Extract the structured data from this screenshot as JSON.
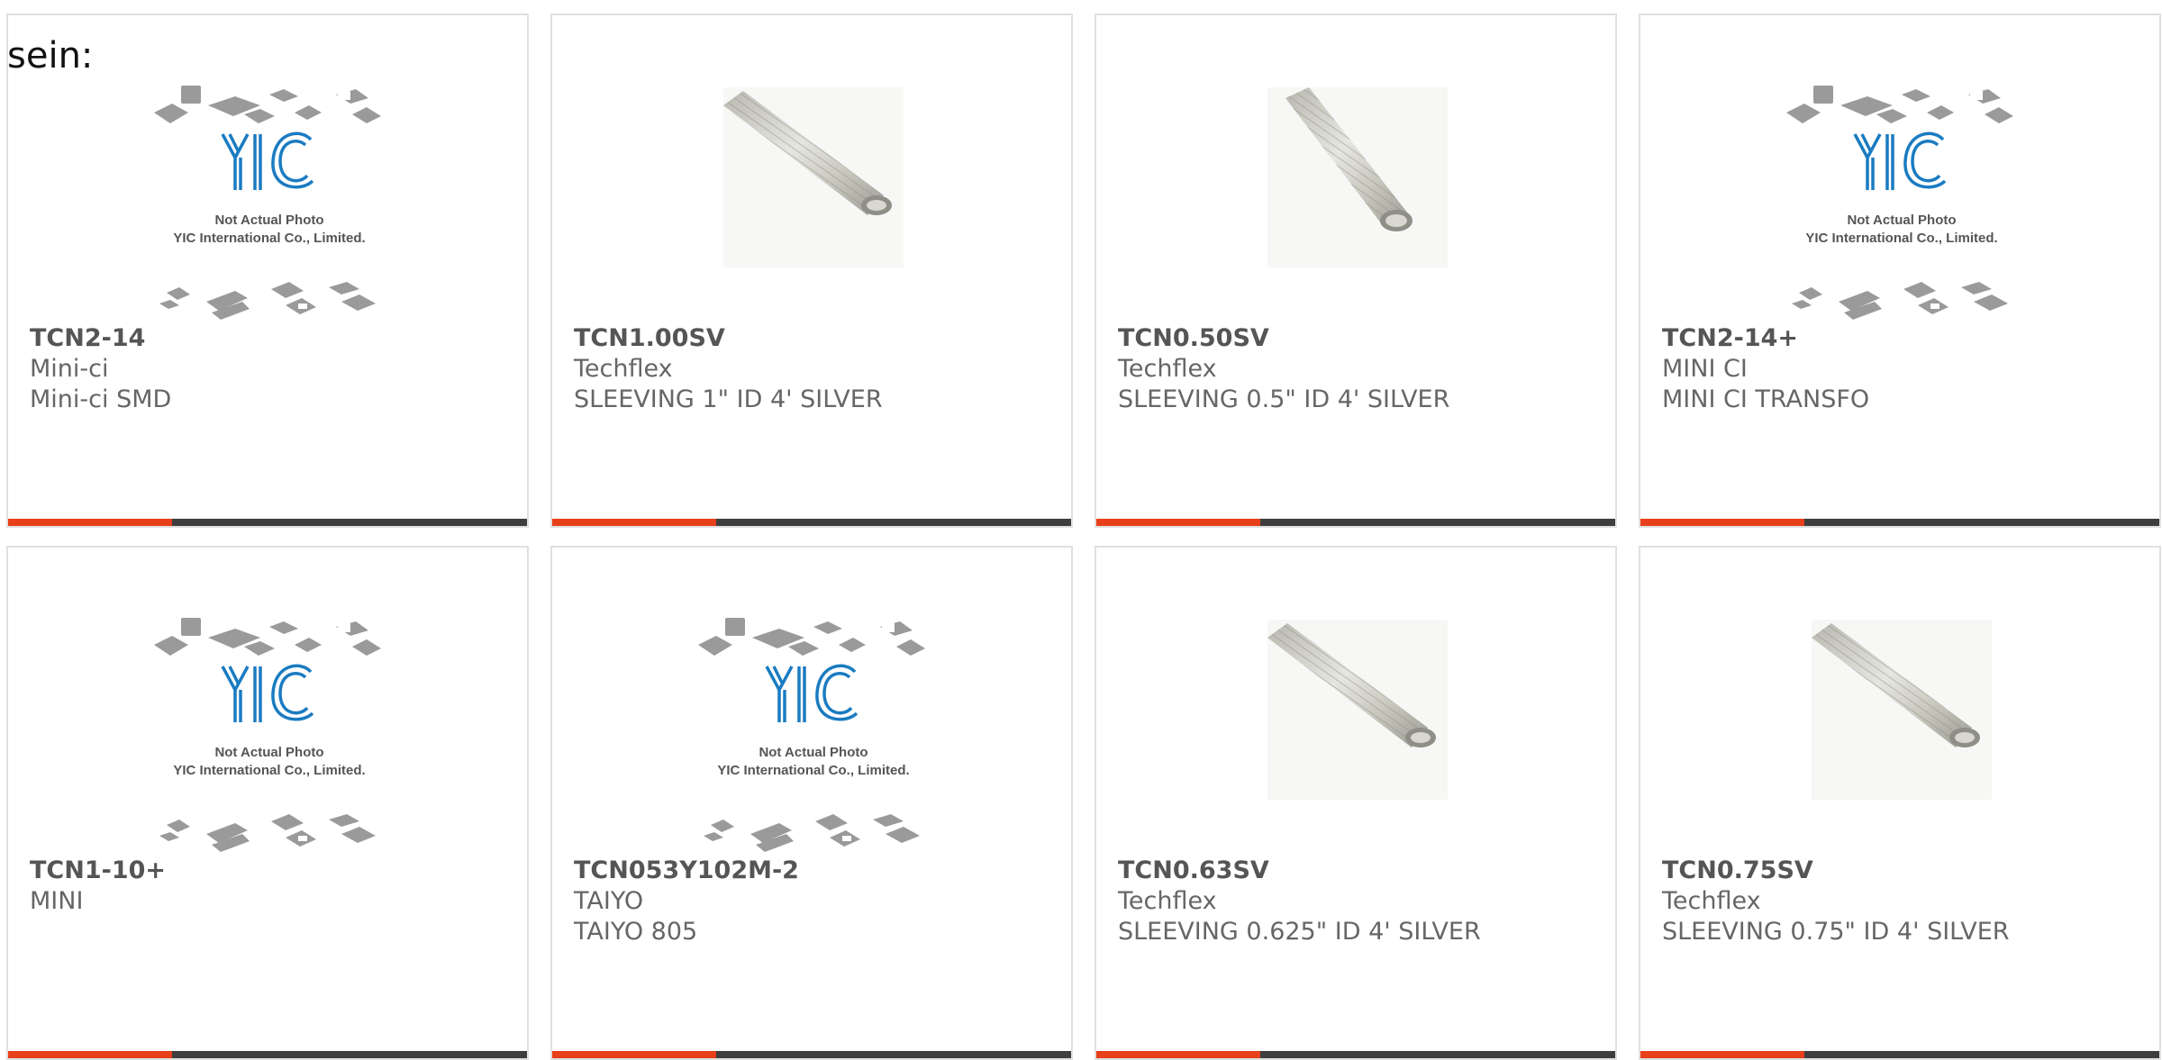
{
  "page": {
    "leading_text": "sein:"
  },
  "accent_color": "#e8401a",
  "bar_color": "#3e3e3e",
  "products": [
    {
      "part_number": "TCN2-14",
      "manufacturer": "Mini-ci",
      "description": "Mini-ci SMD",
      "image": "placeholder-logo",
      "placeholder": {
        "brand": "YIC",
        "line1": "Not Actual Photo",
        "line2": "YIC International Co., Limited."
      }
    },
    {
      "part_number": "TCN1.00SV",
      "manufacturer": "Techflex",
      "description": "SLEEVING 1\" ID 4' SILVER",
      "image": "sleeving-photo"
    },
    {
      "part_number": "TCN0.50SV",
      "manufacturer": "Techflex",
      "description": "SLEEVING 0.5\" ID 4' SILVER",
      "image": "sleeving-photo"
    },
    {
      "part_number": "TCN2-14+",
      "manufacturer": "MINI CI",
      "description": "MINI CI TRANSFO",
      "image": "placeholder-logo",
      "placeholder": {
        "brand": "YIC",
        "line1": "Not Actual Photo",
        "line2": "YIC International Co., Limited."
      }
    },
    {
      "part_number": "TCN1-10+",
      "manufacturer": "MINI",
      "description": "",
      "image": "placeholder-logo",
      "placeholder": {
        "brand": "YIC",
        "line1": "Not Actual Photo",
        "line2": "YIC International Co., Limited."
      }
    },
    {
      "part_number": "TCN053Y102M-2",
      "manufacturer": "TAIYO",
      "description": "TAIYO 805",
      "image": "placeholder-logo",
      "placeholder": {
        "brand": "YIC",
        "line1": "Not Actual Photo",
        "line2": "YIC International Co., Limited."
      }
    },
    {
      "part_number": "TCN0.63SV",
      "manufacturer": "Techflex",
      "description": "SLEEVING 0.625\" ID 4' SILVER",
      "image": "sleeving-photo"
    },
    {
      "part_number": "TCN0.75SV",
      "manufacturer": "Techflex",
      "description": "SLEEVING 0.75\" ID 4' SILVER",
      "image": "sleeving-photo"
    }
  ]
}
